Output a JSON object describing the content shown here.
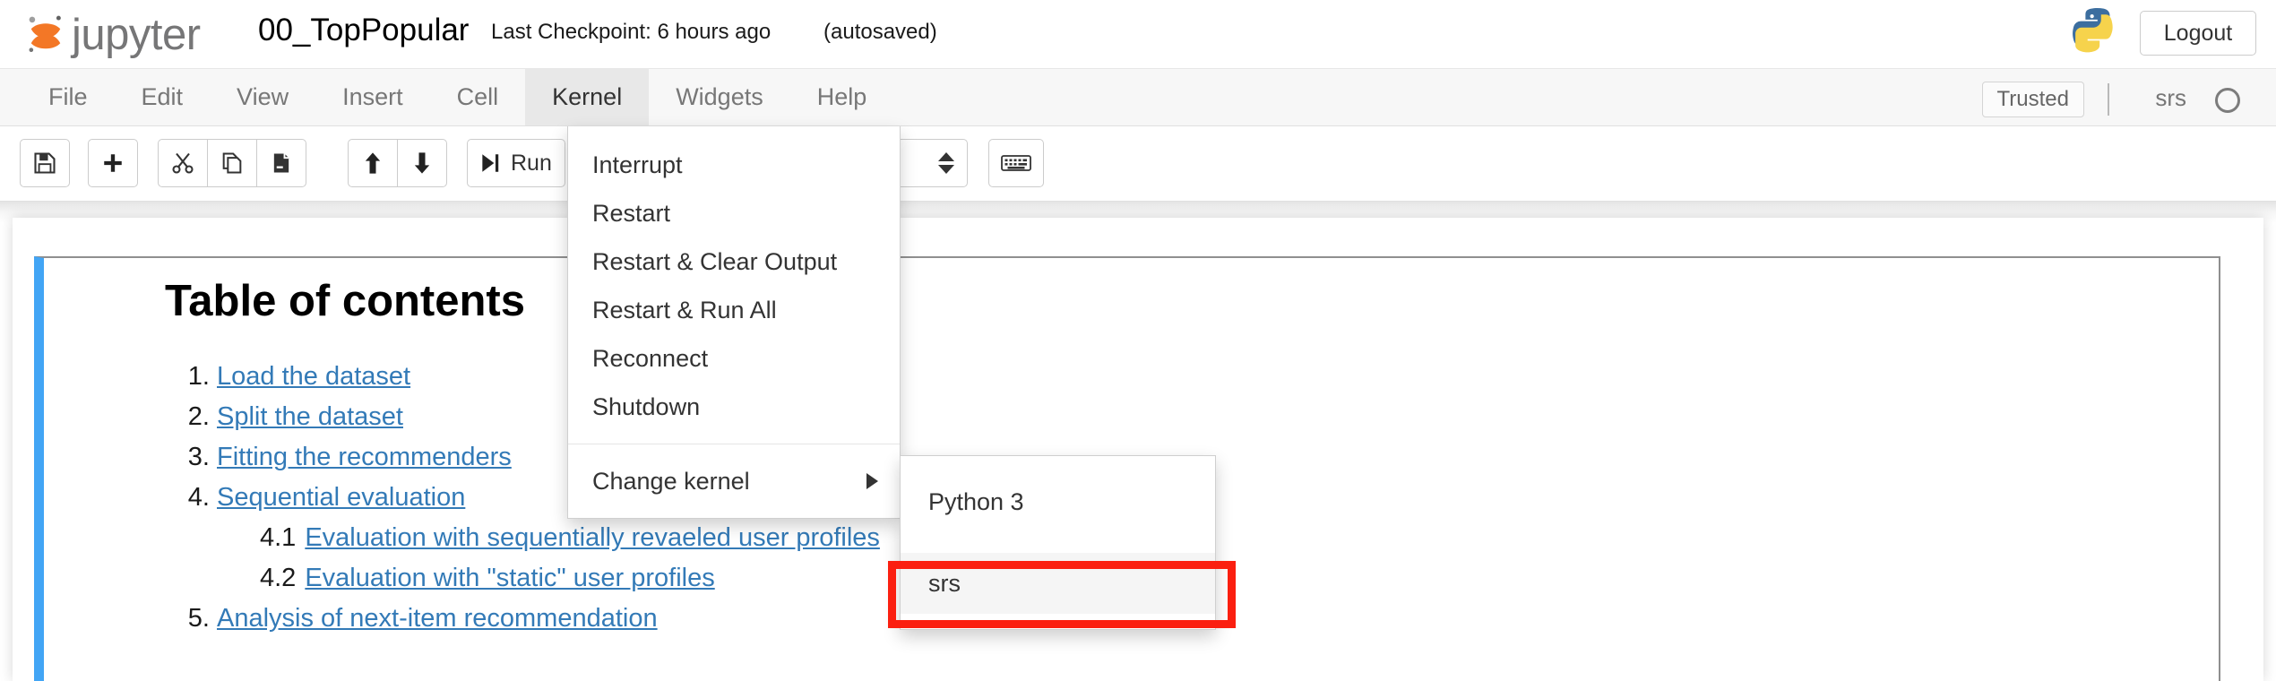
{
  "header": {
    "logo_word": "jupyter",
    "logo_icon": "jupyter-planet-icon",
    "notebook_title": "00_TopPopular",
    "checkpoint": "Last Checkpoint: 6 hours ago",
    "autosaved": "(autosaved)",
    "kernel_logo_icon": "python-logo-icon",
    "logout_label": "Logout"
  },
  "menubar": {
    "items": [
      {
        "label": "File",
        "active": false
      },
      {
        "label": "Edit",
        "active": false
      },
      {
        "label": "View",
        "active": false
      },
      {
        "label": "Insert",
        "active": false
      },
      {
        "label": "Cell",
        "active": false
      },
      {
        "label": "Kernel",
        "active": true
      },
      {
        "label": "Widgets",
        "active": false
      },
      {
        "label": "Help",
        "active": false
      }
    ],
    "trusted_label": "Trusted",
    "kernel_name": "srs",
    "kernel_status_icon": "circle-idle-icon"
  },
  "toolbar": {
    "save_icon": "floppy-disk-icon",
    "insert_icon": "plus-icon",
    "cut_icon": "scissors-icon",
    "copy_icon": "copy-icon",
    "paste_icon": "paste-icon",
    "move_up_icon": "arrow-up-icon",
    "move_down_icon": "arrow-down-icon",
    "run_label": "Run",
    "run_icon": "run-icon",
    "celltype_value": "",
    "celltype_icon": "caret-updown-icon",
    "command_palette_icon": "keyboard-icon"
  },
  "kernel_menu": {
    "items": [
      {
        "label": "Interrupt",
        "submenu": false
      },
      {
        "label": "Restart",
        "submenu": false
      },
      {
        "label": "Restart & Clear Output",
        "submenu": false
      },
      {
        "label": "Restart & Run All",
        "submenu": false
      },
      {
        "label": "Reconnect",
        "submenu": false
      },
      {
        "label": "Shutdown",
        "submenu": false
      }
    ],
    "change_kernel_label": "Change kernel",
    "change_kernel_arrow_icon": "caret-right-icon"
  },
  "kernel_submenu": {
    "items": [
      {
        "label": "Python 3",
        "highlighted": false
      },
      {
        "label": "srs",
        "highlighted": true
      }
    ]
  },
  "notebook": {
    "toc_title": "Table of contents",
    "toc": [
      {
        "num": "1.",
        "label": "Load the dataset",
        "sub": []
      },
      {
        "num": "2.",
        "label": "Split the dataset",
        "sub": []
      },
      {
        "num": "3.",
        "label": "Fitting the recommenders",
        "sub": []
      },
      {
        "num": "4.",
        "label": "Sequential evaluation",
        "sub": [
          {
            "num": "4.1",
            "label": "Evaluation with sequentially revaeled user profiles"
          },
          {
            "num": "4.2",
            "label": "Evaluation with \"static\" user profiles"
          }
        ]
      },
      {
        "num": "5.",
        "label": "Analysis of next-item recommendation",
        "sub": []
      }
    ]
  },
  "colors": {
    "jupyter_orange": "#f37726",
    "cell_selected_blue": "#42a5f5",
    "link_blue": "#337ab7",
    "annotation_red": "#fb1f10",
    "menu_active_bg": "#e8e8e8"
  }
}
